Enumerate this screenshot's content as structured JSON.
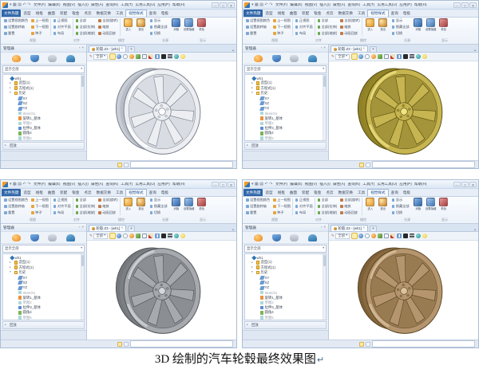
{
  "caption": {
    "text": "3D 绘制的汽车轮毂最终效果图",
    "mark": "↵"
  },
  "app": {
    "titlebar": {
      "logo_icon": "zw3d-app-logo-icon",
      "quick_icons": [
        {
          "ic": "app-menu-icon",
          "glyph": "▾"
        },
        {
          "ic": "save-icon",
          "glyph": "▦"
        },
        {
          "ic": "open-icon",
          "glyph": "▤"
        },
        {
          "ic": "undo-icon",
          "glyph": "↶"
        },
        {
          "ic": "redo-icon",
          "glyph": "↷"
        }
      ],
      "menus": [
        "文件(F)",
        "编辑(E)",
        "视图(V)",
        "插入(I)",
        "属性(A)",
        "查询(N)",
        "工具(T)",
        "实用工具(U)",
        "应用(P)",
        "帮助(H)"
      ],
      "window_buttons": [
        {
          "ic": "minimize-icon",
          "glyph": "—"
        },
        {
          "ic": "maximize-icon",
          "glyph": "□"
        },
        {
          "ic": "close-icon",
          "glyph": "✕"
        }
      ]
    },
    "ribbon": {
      "tabs": [
        {
          "label": "文件热键",
          "cls": "rtab file"
        },
        {
          "label": "造型",
          "cls": "rtab"
        },
        {
          "label": "线框",
          "cls": "rtab"
        },
        {
          "label": "曲面",
          "cls": "rtab"
        },
        {
          "label": "装配",
          "cls": "rtab"
        },
        {
          "label": "钣金",
          "cls": "rtab"
        },
        {
          "label": "点云",
          "cls": "rtab"
        },
        {
          "label": "数据交换",
          "cls": "rtab"
        },
        {
          "label": "工具",
          "cls": "rtab"
        },
        {
          "label": "视觉样式",
          "cls": "rtab sel"
        },
        {
          "label": "查询",
          "cls": "rtab"
        },
        {
          "label": "电极",
          "cls": "rtab"
        }
      ],
      "collapse_glyph": "^",
      "help_glyph": "?",
      "cols": [
        {
          "cls": "rb-col",
          "a": "设置视图颜色",
          "b": "设置旋转轴",
          "c": "重置"
        },
        {
          "cls": "rb-col sep",
          "a": "上一视图",
          "b": "下一视图",
          "c": "种子"
        },
        {
          "cls": "rb-col sep",
          "a": "正视图",
          "b": "对齐平面",
          "c": "布局"
        },
        {
          "cls": "rb-col",
          "a": "全部",
          "b": "全部(拉伸)",
          "c": "全部(缩放)"
        },
        {
          "cls": "rb-col sep",
          "a": "全部(旋转)",
          "b": "缩放",
          "c": "动画回放"
        }
      ],
      "bigs1": [
        {
          "label": "进入",
          "ic": "enter-target-icon",
          "cls": "big b-gold"
        },
        {
          "label": "退出",
          "ic": "exit-target-icon",
          "cls": "big b-gold2"
        }
      ],
      "minis": [
        {
          "label": "显示"
        },
        {
          "label": "隐藏全部"
        },
        {
          "label": "切换"
        }
      ],
      "bigs2": [
        {
          "label": "消隐",
          "ic": "hide-entities-icon",
          "cls": "big b-blue"
        },
        {
          "label": "设置隐藏",
          "ic": "set-hidden-icon",
          "cls": "big b-blue2"
        },
        {
          "label": "着色",
          "ic": "shaded-display-icon",
          "cls": "big b-red"
        }
      ],
      "group_labels": [
        {
          "label": "视图",
          "cls": "gl g1"
        },
        {
          "label": "对齐",
          "cls": "gl g2"
        },
        {
          "label": "操控",
          "cls": "gl g3"
        },
        {
          "label": "光源",
          "cls": "gl g4"
        },
        {
          "label": "显示",
          "cls": "gl g5"
        }
      ]
    },
    "manager": {
      "title": "管理器",
      "header_icons": [
        {
          "ic": "pin-panel-icon",
          "glyph": "▫"
        },
        {
          "ic": "close-panel-icon",
          "glyph": "×"
        }
      ],
      "tools": [
        {
          "ic": "history-manager-icon"
        },
        {
          "ic": "assembly-manager-icon"
        },
        {
          "ic": "visibility-manager-icon"
        },
        {
          "ic": "layer-manager-icon"
        }
      ],
      "filter": {
        "label": "显示全部",
        "caret": "▾"
      },
      "tree": [
        {
          "rowcls": "tree-row",
          "chev": "",
          "ic": "part-icon",
          "label": "wh1"
        },
        {
          "rowcls": "tree-row ind1",
          "chev": "▸",
          "ic": "folder-icon",
          "label": "造型(1)"
        },
        {
          "rowcls": "tree-row ind1",
          "chev": "▸",
          "ic": "folder-icon",
          "label": "方程式(1)"
        },
        {
          "rowcls": "tree-row ind1",
          "chev": "▾",
          "ic": "folder-open-icon",
          "label": "历史"
        },
        {
          "rowcls": "tree-row ind2",
          "ic": "plane-icon",
          "label": "XY"
        },
        {
          "rowcls": "tree-row ind2",
          "ic": "plane-icon",
          "label": "XZ"
        },
        {
          "rowcls": "tree-row ind2",
          "ic": "plane-icon",
          "label": "YZ"
        },
        {
          "rowcls": "tree-row ind2 dim",
          "ic": "sketch-icon",
          "label": "Sketch1"
        },
        {
          "rowcls": "tree-row ind2",
          "ic": "revolve-icon",
          "label": "旋转1_基体"
        },
        {
          "rowcls": "tree-row ind2 dim",
          "ic": "sketch-icon",
          "label": "草图2"
        },
        {
          "rowcls": "tree-row ind2",
          "ic": "extrude-icon",
          "label": "拉伸3_基体"
        },
        {
          "rowcls": "tree-row ind2",
          "ic": "fillet-icon",
          "label": "圆角4"
        },
        {
          "rowcls": "tree-row ind2 dim",
          "ic": "sketch-icon",
          "label": "草图5"
        },
        {
          "rowcls": "tree-row ind2",
          "ic": "extrude-icon",
          "label": "拉伸6_切除"
        },
        {
          "rowcls": "tree-row ind2",
          "ic": "pattern-icon",
          "label": "阵列7"
        },
        {
          "rowcls": "tree-row ind2",
          "ic": "fillet-icon",
          "label": "圆角8"
        }
      ],
      "replay": {
        "chev": "▸",
        "label": "回放"
      }
    },
    "doc": {
      "tab": {
        "title": "轮毂.Z3 - [wh1]",
        "close": "×",
        "plus": "+",
        "corner": "▴"
      },
      "da": {
        "pencil_glyph": "✎",
        "filter_label": "全部",
        "caret": "▾",
        "icons": [
          {
            "ic": "wireframe-icon",
            "cls": "da-ic sel"
          },
          {
            "ic": "shaded-sphere-icon",
            "cls": "da-ic"
          },
          {
            "ic": "hidden-line-icon",
            "cls": "da-ic"
          },
          {
            "ic": "render-sphere-icon",
            "cls": "da-ic"
          },
          {
            "ic": "section-icon",
            "cls": "da-ic"
          },
          {
            "ic": "viewport-icon",
            "cls": "da-ic"
          },
          {
            "ic": "sketch-pencil-icon",
            "cls": "da-ic"
          },
          {
            "ic": "grid-icon",
            "cls": "da-ic"
          },
          {
            "ic": "background-black-icon",
            "cls": "da-ic"
          },
          {
            "ic": "background-stripe-icon",
            "cls": "da-ic"
          },
          {
            "ic": "material-sphere-icon",
            "cls": "da-ic"
          },
          {
            "ic": "light-icon",
            "cls": "da-ic"
          }
        ]
      }
    },
    "status": {
      "icons": [
        {
          "ic": "prompt-note-icon",
          "cls": "st-ic hl"
        },
        {
          "ic": "prompt-list-icon",
          "cls": "st-ic"
        }
      ],
      "input_value": ""
    }
  },
  "windows": [
    {
      "name": "silver-white",
      "wheel": {
        "body": "#eceef2",
        "win": "#d9dce2",
        "dark": "#767d88",
        "mid": "#b7bcc6",
        "hi": "#ffffff",
        "barrel": "#c9ced6"
      }
    },
    {
      "name": "gold",
      "wheel": {
        "body": "#c6b550",
        "win": "#a4943a",
        "dark": "#564b10",
        "mid": "#948627",
        "hi": "#f0e382",
        "barrel": "#8f8128"
      }
    },
    {
      "name": "gray",
      "wheel": {
        "body": "#a6aaae",
        "win": "#8b8f93",
        "dark": "#4d5154",
        "mid": "#7c8084",
        "hi": "#d4d8dc",
        "barrel": "#75797d"
      }
    },
    {
      "name": "bronze",
      "wheel": {
        "body": "#b4956e",
        "win": "#997b51",
        "dark": "#5a4424",
        "mid": "#896a41",
        "hi": "#dcc39f",
        "barrel": "#7d6038"
      }
    }
  ]
}
